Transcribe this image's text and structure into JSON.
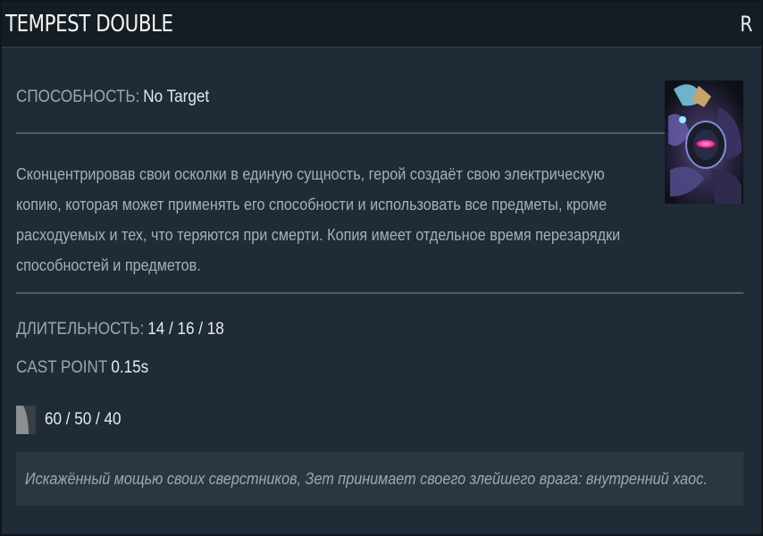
{
  "header": {
    "title": "TEMPEST DOUBLE",
    "hotkey": "R"
  },
  "ability": {
    "label": "СПОСОБНОСТЬ:",
    "value": "No Target"
  },
  "description": [
    "Сконцентрировав свои осколки в единую сущность, герой создаёт свою электрическую",
    "копию, которая может применять его способности и использовать все предметы, кроме",
    "расходуемых и тех, что теряются при смерти. Копия имеет отдельное время перезарядки",
    "способностей и предметов."
  ],
  "stats": {
    "duration_label": "ДЛИТЕЛЬНОСТЬ:",
    "duration_value": "14 / 16 / 18",
    "cast_point_label": "CAST POINT",
    "cast_point_value": "0.15s"
  },
  "cooldown": {
    "icon": "cooldown-icon",
    "value": "60 / 50 / 40"
  },
  "lore": "Искажённый мощью своих сверстников, Зет принимает своего злейшего врага: внутренний хаос.",
  "portrait": {
    "icon": "arc-warden-portrait"
  },
  "colors": {
    "background": "#1f2b36",
    "header": "#151d24",
    "lore_box": "#2a3743",
    "text_label": "#9aa7b1",
    "text_value": "#e6eaed"
  }
}
